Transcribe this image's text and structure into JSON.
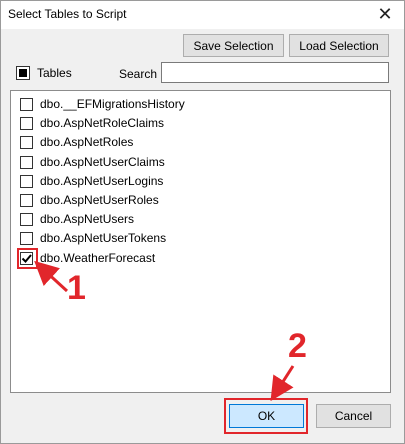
{
  "window": {
    "title": "Select Tables to Script",
    "close_glyph": "✕"
  },
  "toolbar": {
    "save_label": "Save Selection",
    "load_label": "Load Selection"
  },
  "filter": {
    "tables_label": "Tables",
    "search_label": "Search",
    "search_value": ""
  },
  "tables": [
    {
      "label": "dbo.__EFMigrationsHistory",
      "checked": false
    },
    {
      "label": "dbo.AspNetRoleClaims",
      "checked": false
    },
    {
      "label": "dbo.AspNetRoles",
      "checked": false
    },
    {
      "label": "dbo.AspNetUserClaims",
      "checked": false
    },
    {
      "label": "dbo.AspNetUserLogins",
      "checked": false
    },
    {
      "label": "dbo.AspNetUserRoles",
      "checked": false
    },
    {
      "label": "dbo.AspNetUsers",
      "checked": false
    },
    {
      "label": "dbo.AspNetUserTokens",
      "checked": false
    },
    {
      "label": "dbo.WeatherForecast",
      "checked": true
    }
  ],
  "annotations": {
    "step1": "1",
    "step2": "2",
    "color": "#e1262b"
  },
  "footer": {
    "ok_label": "OK",
    "cancel_label": "Cancel"
  },
  "icons": {
    "close": "close-icon",
    "check": "checkmark-icon"
  }
}
